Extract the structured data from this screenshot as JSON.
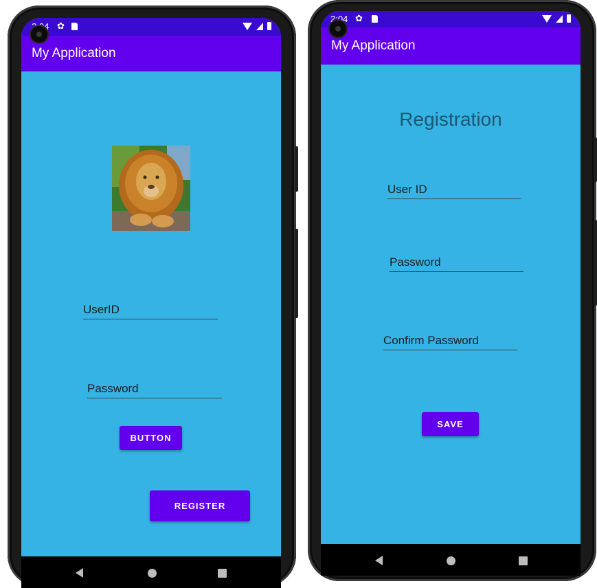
{
  "colors": {
    "app_bar": "#6200ee",
    "status_bar": "#3b0ad0",
    "screen_background": "#35b3e4",
    "button": "#6200ee",
    "nav_bar": "#000000"
  },
  "login_phone": {
    "status_bar": {
      "time": "2:04",
      "icons": [
        "gear-icon",
        "sd-card-icon",
        "wifi-icon",
        "signal-icon",
        "battery-icon"
      ]
    },
    "app_bar": {
      "title": "My Application"
    },
    "image": {
      "icon": "lion-photo"
    },
    "fields": {
      "user_id": "UserID",
      "password": "Password"
    },
    "buttons": {
      "button": "BUTTON",
      "register": "REGISTER"
    },
    "nav_bar": {
      "icons": [
        "back-icon",
        "home-icon",
        "recents-icon"
      ]
    }
  },
  "registration_phone": {
    "status_bar": {
      "time": "2:04",
      "icons": [
        "gear-icon",
        "sd-card-icon",
        "wifi-icon",
        "signal-icon",
        "battery-icon"
      ]
    },
    "app_bar": {
      "title": "My Application"
    },
    "heading": "Registration",
    "fields": {
      "user_id": "User ID",
      "password": "Password",
      "confirm_password": "Confirm Password"
    },
    "buttons": {
      "save": "SAVE"
    },
    "nav_bar": {
      "icons": [
        "back-icon",
        "home-icon",
        "recents-icon"
      ]
    }
  }
}
